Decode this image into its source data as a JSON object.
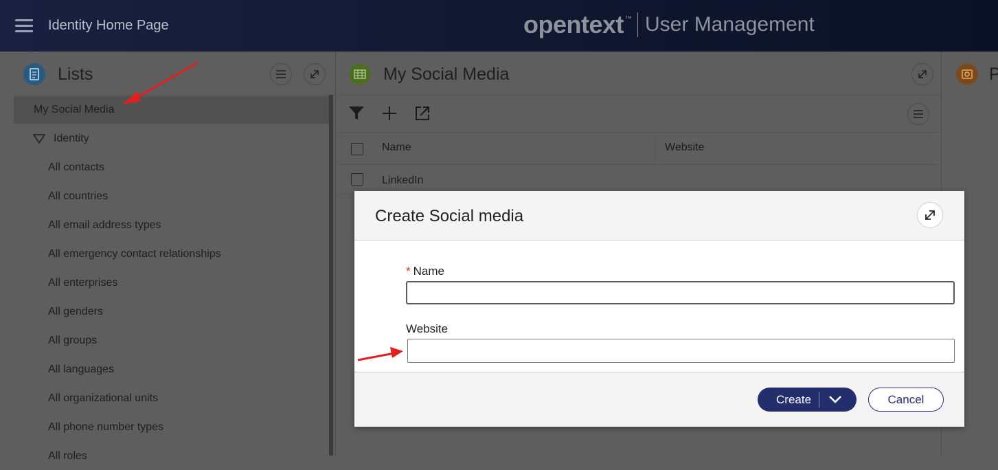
{
  "topbar": {
    "title": "Identity Home Page",
    "brand_logo": "opentext",
    "brand_tm": "™",
    "brand_app": "User Management"
  },
  "lists_panel": {
    "title": "Lists",
    "items": [
      {
        "label": "My Social Media",
        "selected": true
      },
      {
        "label": "Identity",
        "group": true
      },
      {
        "label": "All contacts"
      },
      {
        "label": "All countries"
      },
      {
        "label": "All email address types"
      },
      {
        "label": "All emergency contact relationships"
      },
      {
        "label": "All enterprises"
      },
      {
        "label": "All genders"
      },
      {
        "label": "All groups"
      },
      {
        "label": "All languages"
      },
      {
        "label": "All organizational units"
      },
      {
        "label": "All phone number types"
      },
      {
        "label": "All roles"
      }
    ]
  },
  "social_panel": {
    "title": "My Social Media",
    "columns": [
      "Name",
      "Website"
    ],
    "rows": [
      {
        "name": "LinkedIn",
        "website": ""
      }
    ]
  },
  "right_panel": {
    "title": "P"
  },
  "dialog": {
    "title": "Create Social media",
    "name_label": "Name",
    "name_required_mark": "*",
    "name_value": "",
    "website_label": "Website",
    "website_value": "",
    "create_label": "Create",
    "cancel_label": "Cancel"
  },
  "colors": {
    "accent": "#232e6d",
    "annotation_arrow": "#e02020",
    "lists_icon": "#1e6fa8",
    "social_icon": "#6a9b2f",
    "p_icon": "#c76a1a"
  }
}
